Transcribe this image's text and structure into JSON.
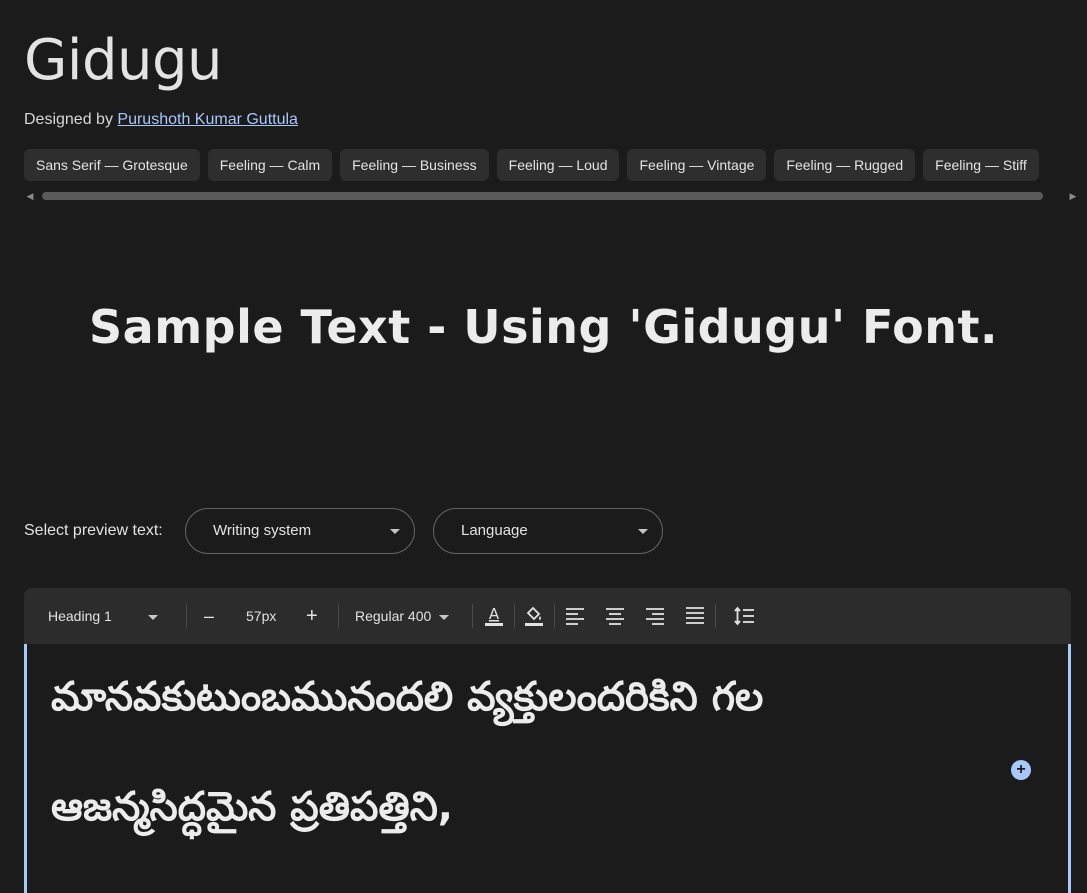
{
  "font": {
    "name": "Gidugu",
    "designed_by_prefix": "Designed by",
    "designer": "Purushoth Kumar Guttula"
  },
  "tags": [
    "Sans Serif — Grotesque",
    "Feeling — Calm",
    "Feeling — Business",
    "Feeling — Loud",
    "Feeling — Vintage",
    "Feeling — Rugged",
    "Feeling — Stiff"
  ],
  "sample_text": "Sample Text - Using 'Gidugu' Font.",
  "preview": {
    "label": "Select preview text:",
    "writing_system_placeholder": "Writing system",
    "language_placeholder": "Language"
  },
  "toolbar": {
    "style_select": "Heading 1",
    "decrease_label": "–",
    "size_value": "57px",
    "increase_label": "+",
    "weight_select": "Regular 400",
    "icons": [
      "text-color-icon",
      "highlight-color-icon",
      "align-left-icon",
      "align-center-icon",
      "align-right-icon",
      "align-justify-icon",
      "line-height-icon"
    ]
  },
  "editor": {
    "line1": "మానవకుటుంబమునందలి వ్యక్తులందరికిని గల",
    "line2": "ఆజన్మసిద్ధమైన ప్రతిపత్తిని,"
  },
  "colors": {
    "background": "#1b1b1b",
    "chip": "#2e2e2e",
    "toolbar": "#2c2c2c",
    "accent": "#a8c7fa"
  }
}
